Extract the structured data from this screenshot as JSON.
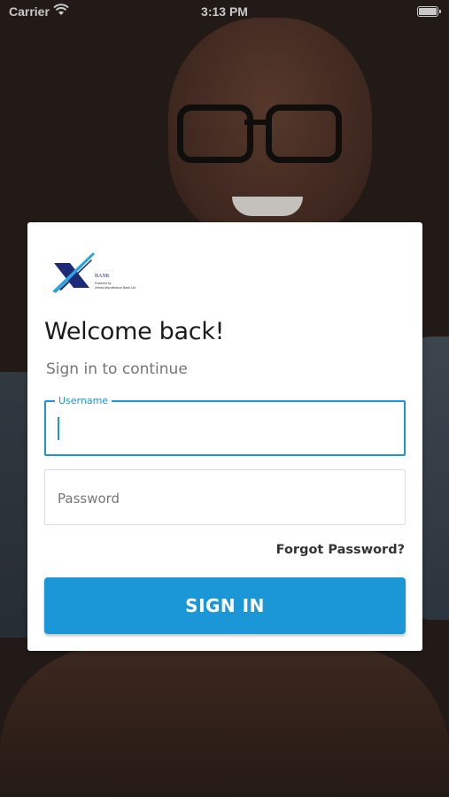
{
  "status_bar": {
    "carrier": "Carrier",
    "time": "3:13 PM",
    "battery_level": 1.0
  },
  "logo": {
    "wordmark": "BANK",
    "tagline_line1": "Powered by",
    "tagline_line2": "Xelera Microfinance Bank Ltd",
    "color_primary": "#1d2a7a",
    "color_accent": "#2ba3dd"
  },
  "login": {
    "title": "Welcome back!",
    "subtitle": "Sign in to continue",
    "username_label": "Username",
    "username_value": "",
    "password_placeholder": "Password",
    "password_value": "",
    "forgot_password": "Forgot Password?",
    "sign_in_button": "SIGN IN"
  },
  "colors": {
    "accent": "#1b97d8",
    "card_background": "#ffffff",
    "title_text": "#1b1b1b",
    "subtitle_text": "#767676"
  },
  "icons": {
    "wifi": "wifi-icon",
    "battery": "battery-icon"
  }
}
